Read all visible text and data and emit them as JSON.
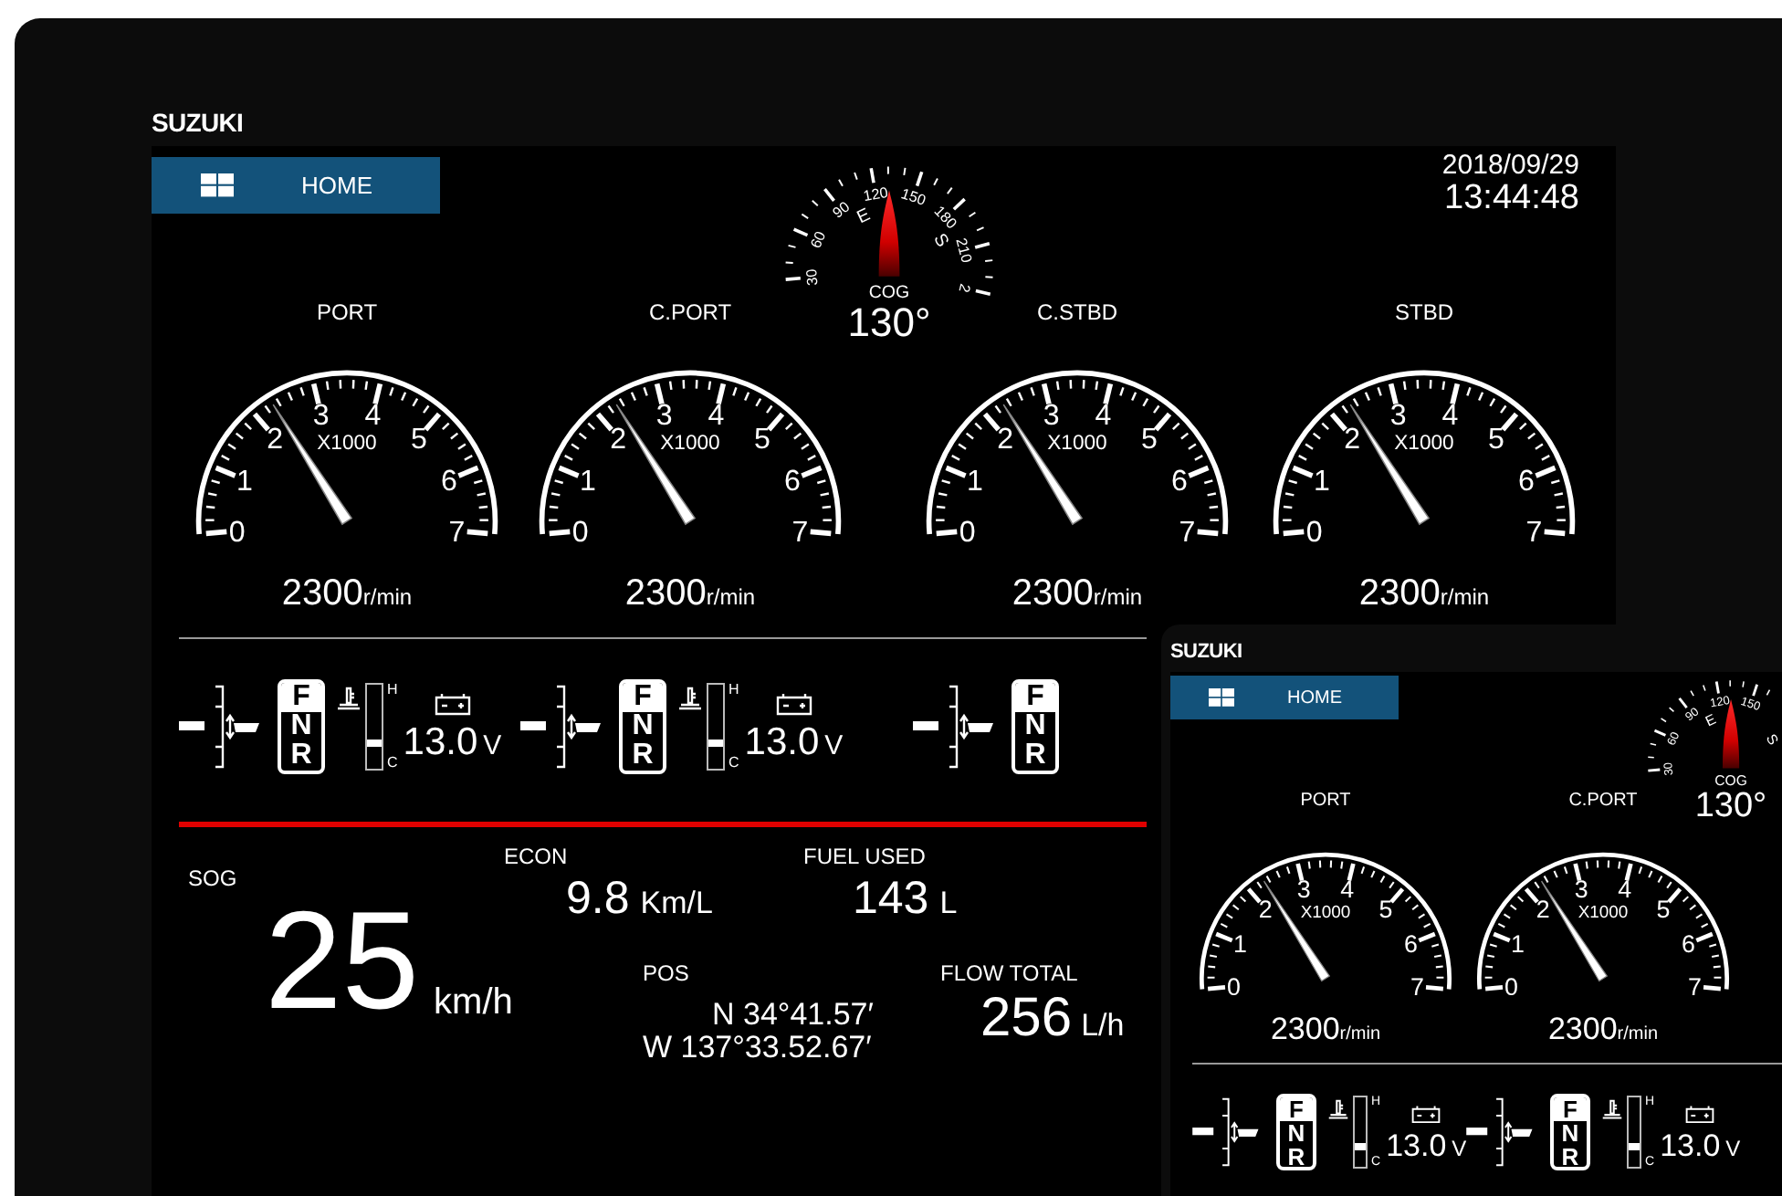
{
  "main": {
    "logo": "SUZUKI",
    "home_button": "HOME",
    "date": "2018/09/29",
    "time": "13:44:48",
    "cog": {
      "label": "COG",
      "value": "130°",
      "scale": [
        {
          "kind": "degree",
          "text": "30"
        },
        {
          "kind": "degree",
          "text": "60"
        },
        {
          "kind": "degree",
          "text": "90"
        },
        {
          "kind": "cardinal",
          "text": "E"
        },
        {
          "kind": "degree",
          "text": "120"
        },
        {
          "kind": "degree",
          "text": "150"
        },
        {
          "kind": "cardinal",
          "text": "S"
        },
        {
          "kind": "degree",
          "text": "180"
        },
        {
          "kind": "degree",
          "text": "210"
        },
        {
          "kind": "degree",
          "text": "2"
        }
      ]
    },
    "tachometers": [
      {
        "name": "PORT",
        "multiplier": "X1000",
        "scale": [
          "0",
          "1",
          "2",
          "3",
          "4",
          "5",
          "6",
          "7"
        ],
        "level": 0.33,
        "reading": "2300",
        "unit": "r/min"
      },
      {
        "name": "C.PORT",
        "multiplier": "X1000",
        "scale": [
          "0",
          "1",
          "2",
          "3",
          "4",
          "5",
          "6",
          "7"
        ],
        "level": 0.33,
        "reading": "2300",
        "unit": "r/min"
      },
      {
        "name": "C.STBD",
        "multiplier": "X1000",
        "scale": [
          "0",
          "1",
          "2",
          "3",
          "4",
          "5",
          "6",
          "7"
        ],
        "level": 0.33,
        "reading": "2300",
        "unit": "r/min"
      },
      {
        "name": "STBD",
        "multiplier": "X1000",
        "scale": [
          "0",
          "1",
          "2",
          "3",
          "4",
          "5",
          "6",
          "7"
        ],
        "level": 0.33,
        "reading": "2300",
        "unit": "r/min"
      }
    ],
    "engines": [
      {
        "gears": [
          {
            "label": "F",
            "selected": true
          },
          {
            "label": "N",
            "selected": false
          },
          {
            "label": "R",
            "selected": false
          }
        ],
        "temp": {
          "high": "H",
          "low": "C",
          "level": 0.3
        },
        "voltage": "13.0",
        "voltage_unit": "V"
      },
      {
        "gears": [
          {
            "label": "F",
            "selected": true
          },
          {
            "label": "N",
            "selected": false
          },
          {
            "label": "R",
            "selected": false
          }
        ],
        "temp": {
          "high": "H",
          "low": "C",
          "level": 0.3
        },
        "voltage": "13.0",
        "voltage_unit": "V"
      },
      {
        "gears": [
          {
            "label": "F",
            "selected": true
          },
          {
            "label": "N",
            "selected": false
          },
          {
            "label": "R",
            "selected": false
          }
        ]
      }
    ],
    "sog": {
      "label": "SOG",
      "value": "25",
      "unit": "km/h"
    },
    "econ": {
      "label": "ECON",
      "value": "9.8",
      "unit": "Km/L"
    },
    "fuel_used": {
      "label": "FUEL USED",
      "value": "143",
      "unit": "L"
    },
    "pos": {
      "label": "POS",
      "lat": "N 34°41.57′",
      "lon": "W 137°33.52.67′"
    },
    "flow_total": {
      "label": "FLOW TOTAL",
      "value": "256",
      "unit": "L/h"
    }
  },
  "second": {
    "logo": "SUZUKI",
    "home_button": "HOME",
    "cog": {
      "label": "COG",
      "value": "130°",
      "scale": [
        {
          "kind": "degree",
          "text": "30"
        },
        {
          "kind": "degree",
          "text": "60"
        },
        {
          "kind": "degree",
          "text": "90"
        },
        {
          "kind": "cardinal",
          "text": "E"
        },
        {
          "kind": "degree",
          "text": "120"
        },
        {
          "kind": "degree",
          "text": "150"
        },
        {
          "kind": "cardinal",
          "text": "S"
        }
      ]
    },
    "tachometers": [
      {
        "name": "PORT",
        "multiplier": "X1000",
        "scale": [
          "0",
          "1",
          "2",
          "3",
          "4",
          "5",
          "6",
          "7"
        ],
        "level": 0.33,
        "reading": "2300",
        "unit": "r/min"
      },
      {
        "name": "C.PORT",
        "multiplier": "X1000",
        "scale": [
          "0",
          "1",
          "2",
          "3",
          "4",
          "5",
          "6",
          "7"
        ],
        "level": 0.33,
        "reading": "2300",
        "unit": "r/min"
      }
    ],
    "engines": [
      {
        "gears": [
          {
            "label": "F",
            "selected": true
          },
          {
            "label": "N",
            "selected": false
          },
          {
            "label": "R",
            "selected": false
          }
        ],
        "temp": {
          "high": "H",
          "low": "C",
          "level": 0.3
        },
        "voltage": "13.0",
        "voltage_unit": "V"
      },
      {
        "gears": [
          {
            "label": "F",
            "selected": true
          },
          {
            "label": "N",
            "selected": false
          },
          {
            "label": "R",
            "selected": false
          }
        ],
        "temp": {
          "high": "H",
          "low": "C",
          "level": 0.3
        },
        "voltage": "13.0",
        "voltage_unit": "V"
      }
    ]
  }
}
